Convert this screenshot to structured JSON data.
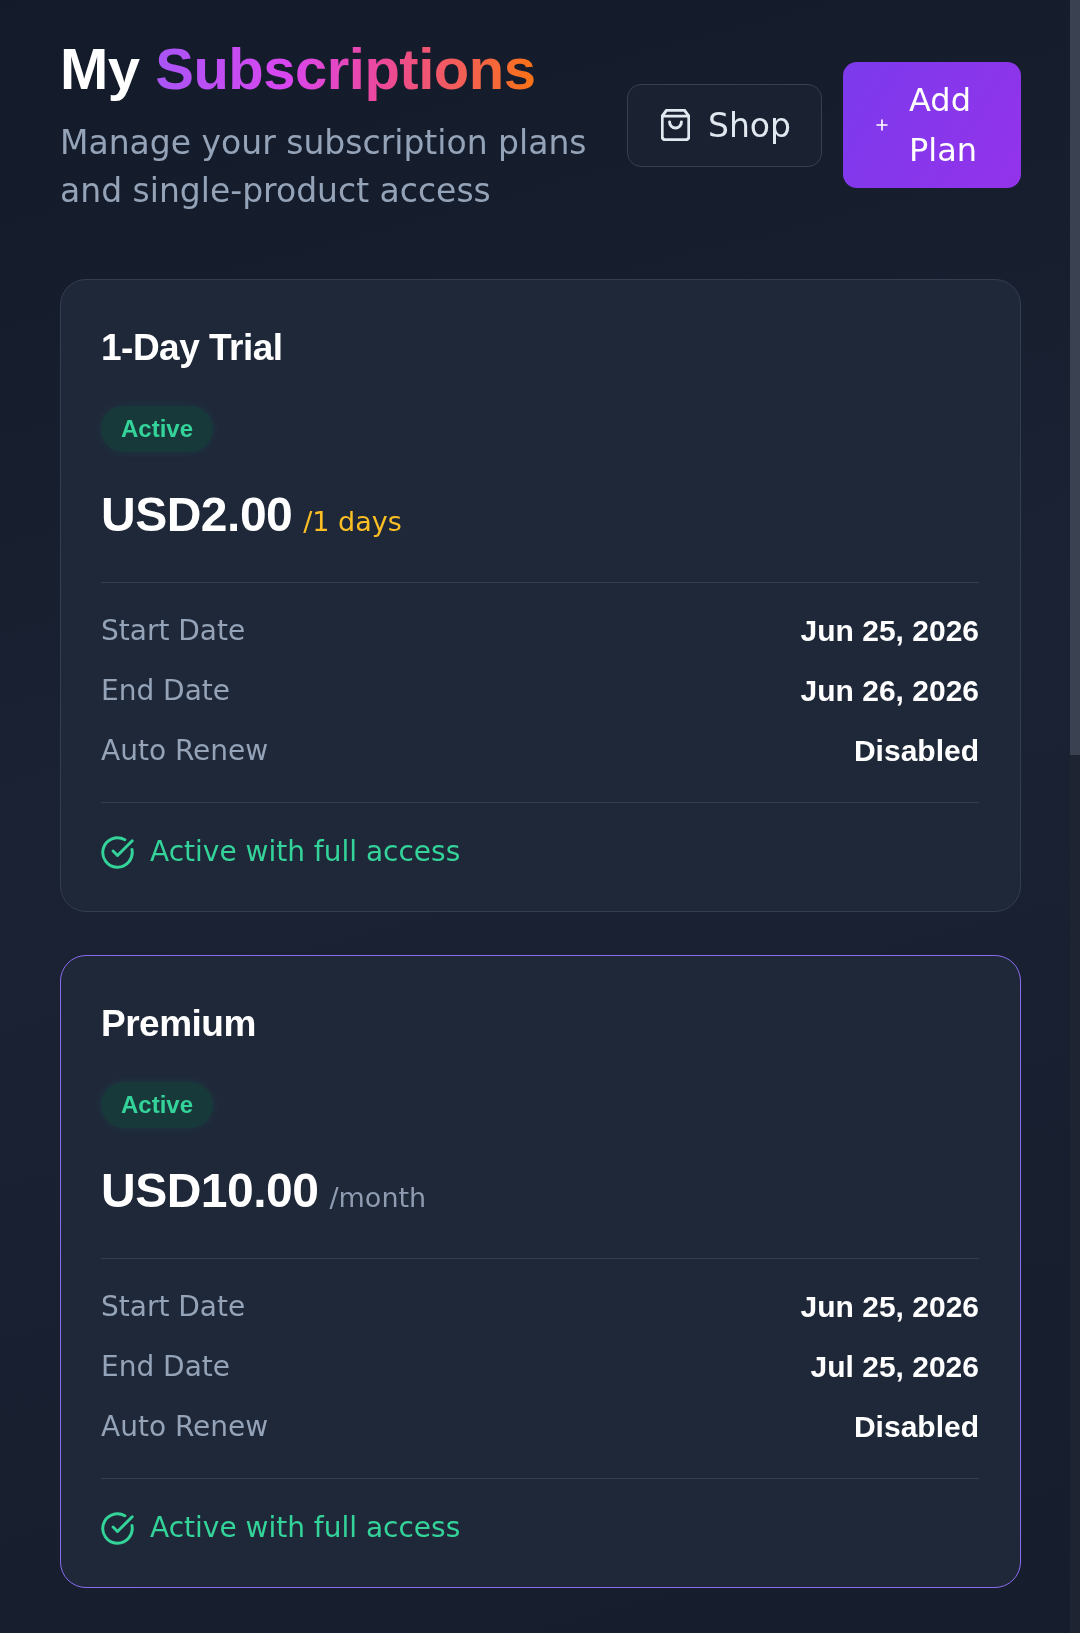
{
  "header": {
    "title": [
      {
        "text": "My",
        "kind": "plain"
      },
      {
        "text": "Subscriptions",
        "kind": "gradient"
      }
    ],
    "subtitle": "Manage your subscription plans and single-product access",
    "buttons": [
      {
        "kind": "secondary",
        "label": "Shop"
      },
      {
        "kind": "primary",
        "label": "Add Plan"
      }
    ]
  },
  "plans": [
    {
      "name": "1-Day Trial",
      "kind": "trial",
      "highlighted": false,
      "status": "Active",
      "price": "USD2.00",
      "period": "/1 days",
      "details": [
        {
          "label": "Start Date",
          "value": "Jun 25, 2026"
        },
        {
          "label": "End Date",
          "value": "Jun 26, 2026"
        },
        {
          "label": "Auto Renew",
          "value": "Disabled"
        }
      ],
      "access_note": "Active with full access"
    },
    {
      "name": "Premium",
      "kind": "recurring",
      "highlighted": true,
      "status": "Active",
      "price": "USD10.00",
      "period": "/month",
      "details": [
        {
          "label": "Start Date",
          "value": "Jun 25, 2026"
        },
        {
          "label": "End Date",
          "value": "Jul 25, 2026"
        },
        {
          "label": "Auto Renew",
          "value": "Disabled"
        }
      ],
      "access_note": "Active with full access"
    }
  ]
}
